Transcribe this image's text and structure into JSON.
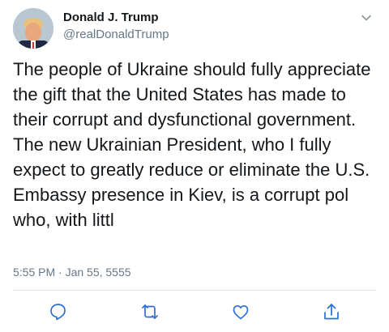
{
  "tweet": {
    "author": {
      "display_name": "Donald J. Trump",
      "handle": "@realDonaldTrump",
      "avatar_icon": "profile-avatar"
    },
    "menu_icon": "chevron-down-icon",
    "text": "The people of Ukraine should fully appreciate the gift that the United States has made to their corrupt and dysfunctional government. The new Ukrainian President, who I fully expect to greatly reduce or eliminate the U.S. Embassy presence in Kiev, is a corrupt pol who, with littl",
    "timestamp": "5:55 PM · Jan 55, 5555",
    "actions": [
      {
        "icon": "reply-icon"
      },
      {
        "icon": "retweet-icon"
      },
      {
        "icon": "like-icon"
      },
      {
        "icon": "share-icon"
      }
    ]
  },
  "colors": {
    "text": "#14171a",
    "secondary": "#657786",
    "icon": "#2f6fd1",
    "divider": "#e1e8ed"
  }
}
